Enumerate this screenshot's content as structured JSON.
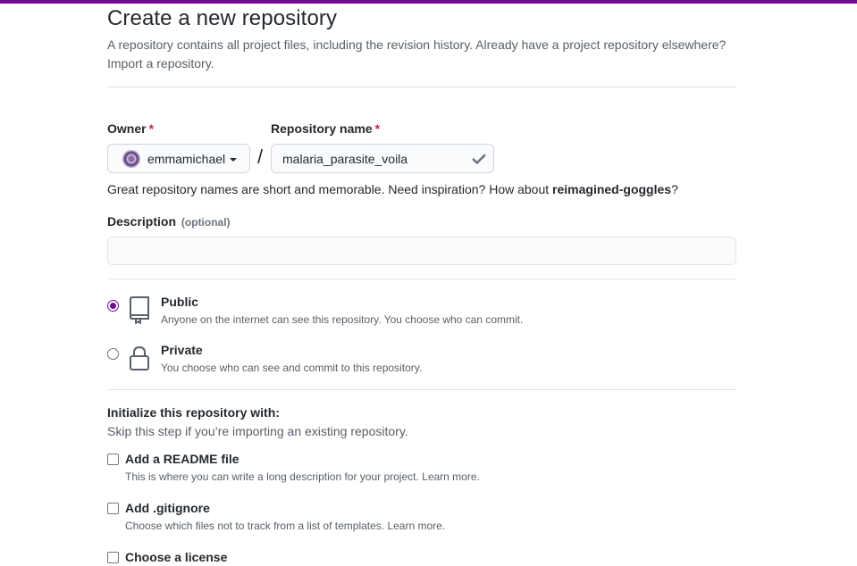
{
  "colors": {
    "accent": "#6f0e8c",
    "required": "#cb2431",
    "muted": "#586069",
    "border": "#e1e4e8"
  },
  "header": {
    "title": "Create a new repository",
    "subtitle_line1": "A repository contains all project files, including the revision history. Already have a project repository elsewhere?",
    "import_link": "Import a repository."
  },
  "owner": {
    "label": "Owner",
    "required_mark": "*",
    "value": "emmamichael",
    "avatar_icon": "user-avatar",
    "dropdown_icon": "caret-down-icon"
  },
  "separator": "/",
  "repo_name": {
    "label": "Repository name",
    "required_mark": "*",
    "value": "malaria_parasite_voila",
    "status_icon": "check-icon"
  },
  "name_hint": {
    "prefix": "Great repository names are short and memorable. Need inspiration? How about ",
    "suggestion": "reimagined-goggles",
    "suffix": "?"
  },
  "description": {
    "label": "Description",
    "optional": "(optional)",
    "value": ""
  },
  "visibility": [
    {
      "title": "Public",
      "desc": "Anyone on the internet can see this repository. You choose who can commit.",
      "selected": true,
      "icon": "repo-icon"
    },
    {
      "title": "Private",
      "desc": "You choose who can see and commit to this repository.",
      "selected": false,
      "icon": "lock-icon"
    }
  ],
  "initialize": {
    "title": "Initialize this repository with:",
    "subtitle": "Skip this step if you’re importing an existing repository.",
    "options": [
      {
        "title": "Add a README file",
        "desc": "This is where you can write a long description for your project. Learn more.",
        "checked": false
      },
      {
        "title": "Add .gitignore",
        "desc": "Choose which files not to track from a list of templates. Learn more.",
        "checked": false
      },
      {
        "title": "Choose a license",
        "desc": "",
        "checked": false
      }
    ]
  }
}
